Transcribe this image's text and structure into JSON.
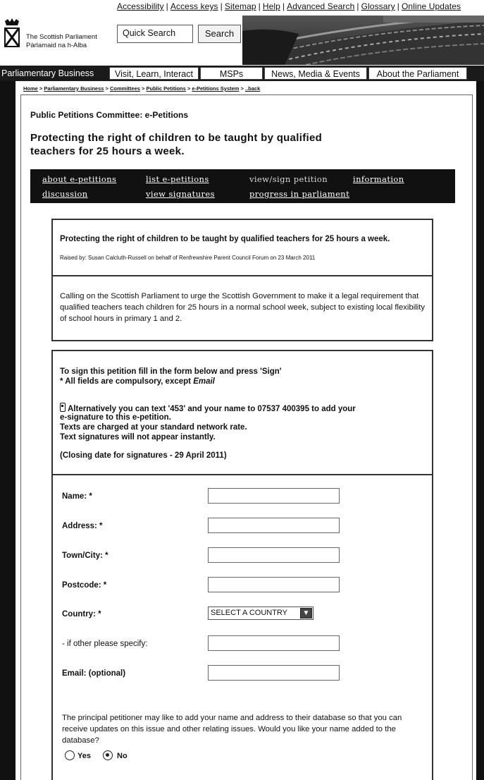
{
  "top_links": [
    "Accessibility",
    "Access keys",
    "Sitemap",
    "Help",
    "Advanced Search",
    "Glossary",
    "Online Updates"
  ],
  "header": {
    "logo_line1": "The Scottish Parliament",
    "logo_line2": "Pàrlamaid na h-Alba",
    "quick_search_label": "Quick Search",
    "search_button": "Search"
  },
  "main_nav": [
    "Parliamentary Business",
    "Visit, Learn, Interact",
    "MSPs",
    "News, Media & Events",
    "About the Parliament"
  ],
  "breadcrumb": [
    "Home",
    "Parliamentary Business",
    "Committees",
    "Public Petitions",
    "e-Petitions System",
    "..back"
  ],
  "committee_heading": "Public Petitions Committee: e-Petitions",
  "page_title": "Protecting the right of children to be taught by qualified teachers for 25 hours a week.",
  "petition_nav": {
    "about": "about e-petitions",
    "list": "list e-petitions",
    "view_sign": "view/sign petition",
    "information": "information",
    "discussion": "discussion",
    "view_signatures": "view signatures",
    "progress": "progress in parliament"
  },
  "summary": {
    "title": "Protecting the right of children to be taught by qualified teachers for 25 hours a week.",
    "raised_by": "Raised by: Susan Calcluth-Russell on behalf of Renfrewshire Parent Council Forum on 23 March 2011",
    "calling": "Calling on the Scottish Parliament to urge the Scottish Government to make it a legal requirement that qualified teachers teach children for 25 hours in a normal school week, subject to existing local flexibility of school hours in primary 1 and 2."
  },
  "instructions": {
    "line1": "To sign this petition fill in the form below and press 'Sign'",
    "line2_prefix": "* All fields are compulsory, except ",
    "line2_email": "Email",
    "text_line1": "Alternatively you can text '453' and your name to 07537 400395 to add your",
    "text_line2": "e-signature to this e-petition.",
    "text_line3": "Texts are charged at your standard network rate.",
    "text_line4": "Text signatures will not appear instantly.",
    "closing": "(Closing date for signatures - 29 April 2011)"
  },
  "form": {
    "name_label": "Name: *",
    "address_label": "Address: *",
    "town_label": "Town/City: *",
    "postcode_label": "Postcode: *",
    "country_label": "Country: *",
    "country_selected": "SELECT A COUNTRY",
    "other_label": "- if other please specify:",
    "email_label": "Email: (optional)",
    "name_value": "",
    "address_value": "",
    "town_value": "",
    "postcode_value": "",
    "other_value": "",
    "email_value": ""
  },
  "database": {
    "question": "The principal petitioner may like to add your name and address to their database so that you can receive updates on this issue and other relating issues. Would you like your name added to the database?",
    "yes_label": "Yes",
    "no_label": "No",
    "selected": "No"
  },
  "icons": {
    "phone": "mobile-phone-icon",
    "select_arrow": "chevron-down-icon",
    "crest": "parliament-crest-icon"
  }
}
